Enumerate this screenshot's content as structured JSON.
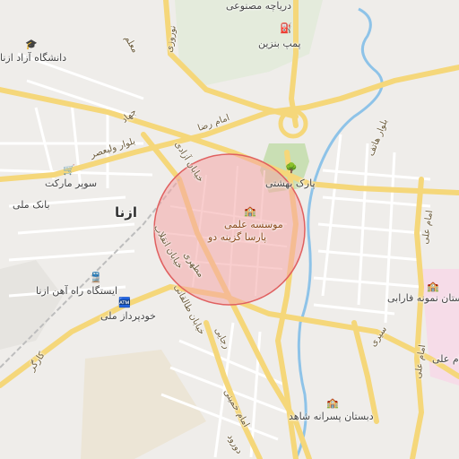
{
  "map": {
    "city": "ازنا",
    "highlight": {
      "fill": "#f4a6a6",
      "stroke": "#e06060",
      "opacity": 0.55
    },
    "colors": {
      "background": "#efedea",
      "road_major": "#f5d77a",
      "road_minor": "#ffffff",
      "park": "#c9dfb4",
      "water": "#8ec3e8",
      "greenbelt": "#d6e8c6"
    },
    "streets": {
      "amam_reza": "امام رضا",
      "blvd_valiasr": "بلوار ولیعصر",
      "khiaban_azadi": "خیابان آزادی",
      "enghelab": "خیابان انقلاب",
      "motahari": "مطهری",
      "taleghani": "خیابان طالقانی",
      "rajaei": "رجایی",
      "amam_khomeini": "امام خمینی",
      "blvd_hatef": "بلوار هاتف",
      "amam_ali": "امام علی",
      "sibri": "سیری",
      "kargar": "کارگر",
      "jahad": "جهاد",
      "nowruzi": "نوروزی",
      "maalem": "معلم",
      "dorud": "دورود"
    },
    "pois": {
      "azad_university": "دانشگاه آزاد ازنا",
      "darya_masnooi": "دریاچه مصنوعی",
      "pump_benzin": "پمپ بنزین",
      "super_market": "سوپر مارکت",
      "bank_melli": "بانک ملی",
      "park_behesht": "پارک بهشتی",
      "institute_line1": "موسسه علمی",
      "institute_line2": "پارسا گزینه دو",
      "rail_station": "ایستگاه راه آهن ازنا",
      "khodro_melli": "خودپرداز ملی",
      "farabi_school": "دبستان نمونه فارابی",
      "shahed_school": "دبستان پسرانه شاهد",
      "amam_ali_partial": "امام علی"
    },
    "icons": {
      "university": "graduation-cap-icon",
      "fuel": "fuel-pump-icon",
      "cart": "shopping-cart-icon",
      "tree": "tree-icon",
      "school": "school-icon",
      "train": "train-icon",
      "atm": "atm-icon"
    }
  }
}
